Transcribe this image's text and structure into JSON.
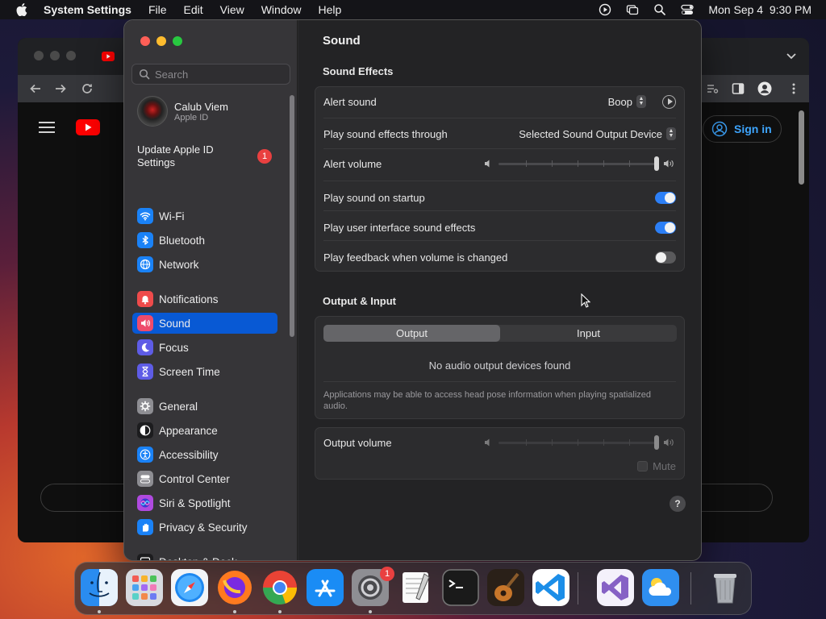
{
  "menubar": {
    "app_name": "System Settings",
    "items": [
      "File",
      "Edit",
      "View",
      "Window",
      "Help"
    ],
    "clock": "Mon Sep 4  9:30 PM"
  },
  "browser": {
    "signin_label": "Sign in"
  },
  "sidebar": {
    "search_placeholder": "Search",
    "profile": {
      "name": "Calub Viem",
      "subtitle": "Apple ID"
    },
    "update": {
      "label": "Update Apple ID Settings",
      "badge": "1"
    },
    "items": [
      {
        "label": "Wi-Fi",
        "icon": "wifi-icon",
        "color": "#1a82f7"
      },
      {
        "label": "Bluetooth",
        "icon": "bluetooth-icon",
        "color": "#1a82f7"
      },
      {
        "label": "Network",
        "icon": "globe-icon",
        "color": "#1a82f7"
      },
      {
        "label": "Notifications",
        "icon": "bell-icon",
        "color": "#ee4b4b"
      },
      {
        "label": "Sound",
        "icon": "speaker-icon",
        "color": "#ee4b6b",
        "active": true
      },
      {
        "label": "Focus",
        "icon": "moon-icon",
        "color": "#5e5ce6"
      },
      {
        "label": "Screen Time",
        "icon": "hourglass-icon",
        "color": "#5e5ce6"
      },
      {
        "label": "General",
        "icon": "gear-icon",
        "color": "#8e8e93"
      },
      {
        "label": "Appearance",
        "icon": "appearance-icon",
        "color": "#1c1c1e"
      },
      {
        "label": "Accessibility",
        "icon": "accessibility-icon",
        "color": "#1a82f7"
      },
      {
        "label": "Control Center",
        "icon": "control-center-icon",
        "color": "#8e8e93"
      },
      {
        "label": "Siri & Spotlight",
        "icon": "siri-icon",
        "color": "#b04ae0"
      },
      {
        "label": "Privacy & Security",
        "icon": "hand-icon",
        "color": "#1a82f7"
      },
      {
        "label": "Desktop & Dock",
        "icon": "dock-icon",
        "color": "#1c1c1e"
      }
    ]
  },
  "content": {
    "title": "Sound",
    "sound_effects": {
      "heading": "Sound Effects",
      "alert_sound_label": "Alert sound",
      "alert_sound_value": "Boop",
      "output_through_label": "Play sound effects through",
      "output_through_value": "Selected Sound Output Device",
      "alert_volume_label": "Alert volume",
      "alert_volume_level": 0.99,
      "startup_label": "Play sound on startup",
      "startup_on": true,
      "ui_effects_label": "Play user interface sound effects",
      "ui_effects_on": true,
      "feedback_label": "Play feedback when volume is changed",
      "feedback_on": false
    },
    "output_input": {
      "heading": "Output & Input",
      "tabs": [
        "Output",
        "Input"
      ],
      "active_tab": "Output",
      "empty_message": "No audio output devices found",
      "note": "Applications may be able to access head pose information when playing spatialized audio."
    },
    "output_volume": {
      "label": "Output volume",
      "level": 0.99,
      "mute_label": "Mute"
    },
    "help_label": "?"
  },
  "dock": {
    "apps": [
      {
        "name": "Finder",
        "icon": "finder-icon",
        "running": true
      },
      {
        "name": "Launchpad",
        "icon": "launchpad-icon",
        "running": false
      },
      {
        "name": "Safari",
        "icon": "safari-icon",
        "running": false
      },
      {
        "name": "Firefox",
        "icon": "firefox-icon",
        "running": true
      },
      {
        "name": "Chrome",
        "icon": "chrome-icon",
        "running": true
      },
      {
        "name": "App Store",
        "icon": "app-store-icon",
        "running": false
      },
      {
        "name": "System Settings",
        "icon": "system-settings-icon",
        "running": true,
        "badge": "1"
      },
      {
        "name": "TextEdit",
        "icon": "textedit-icon",
        "running": false
      },
      {
        "name": "Terminal",
        "icon": "terminal-icon",
        "running": false
      },
      {
        "name": "GarageBand",
        "icon": "garageband-icon",
        "running": false
      },
      {
        "name": "Visual Studio Code",
        "icon": "vscode-icon",
        "running": false
      },
      {
        "name": "Visual Studio",
        "icon": "visual-studio-icon",
        "running": false
      },
      {
        "name": "Weather",
        "icon": "weather-icon",
        "running": false
      },
      {
        "name": "Trash",
        "icon": "trash-icon",
        "running": false
      }
    ]
  }
}
